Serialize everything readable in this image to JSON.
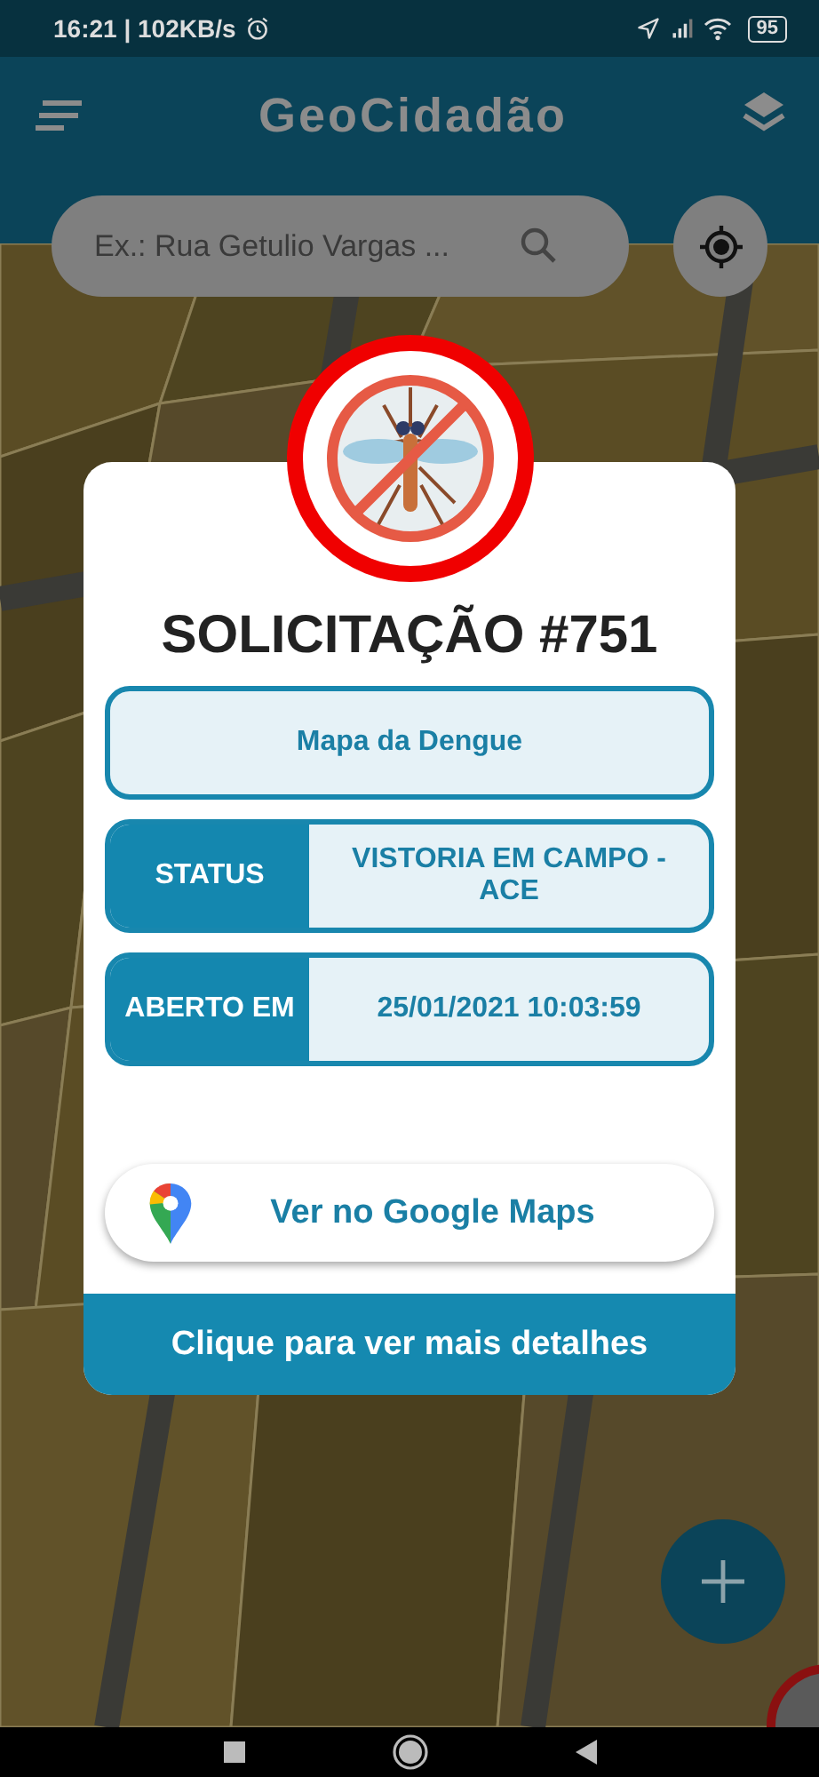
{
  "status_bar": {
    "time_speed": "16:21 | 102KB/s",
    "battery": "95"
  },
  "app_bar": {
    "title": "GeoCidadão"
  },
  "search": {
    "placeholder": "Ex.: Rua Getulio Vargas ..."
  },
  "dialog": {
    "title": "SOLICITAÇÃO #751",
    "category": "Mapa da Dengue",
    "fields": [
      {
        "label": "STATUS",
        "value": "VISTORIA EM CAMPO - ACE"
      },
      {
        "label": "ABERTO EM",
        "value": "25/01/2021 10:03:59"
      }
    ],
    "maps_button": "Ver no Google Maps",
    "details_button": "Clique para ver mais detalhes"
  }
}
